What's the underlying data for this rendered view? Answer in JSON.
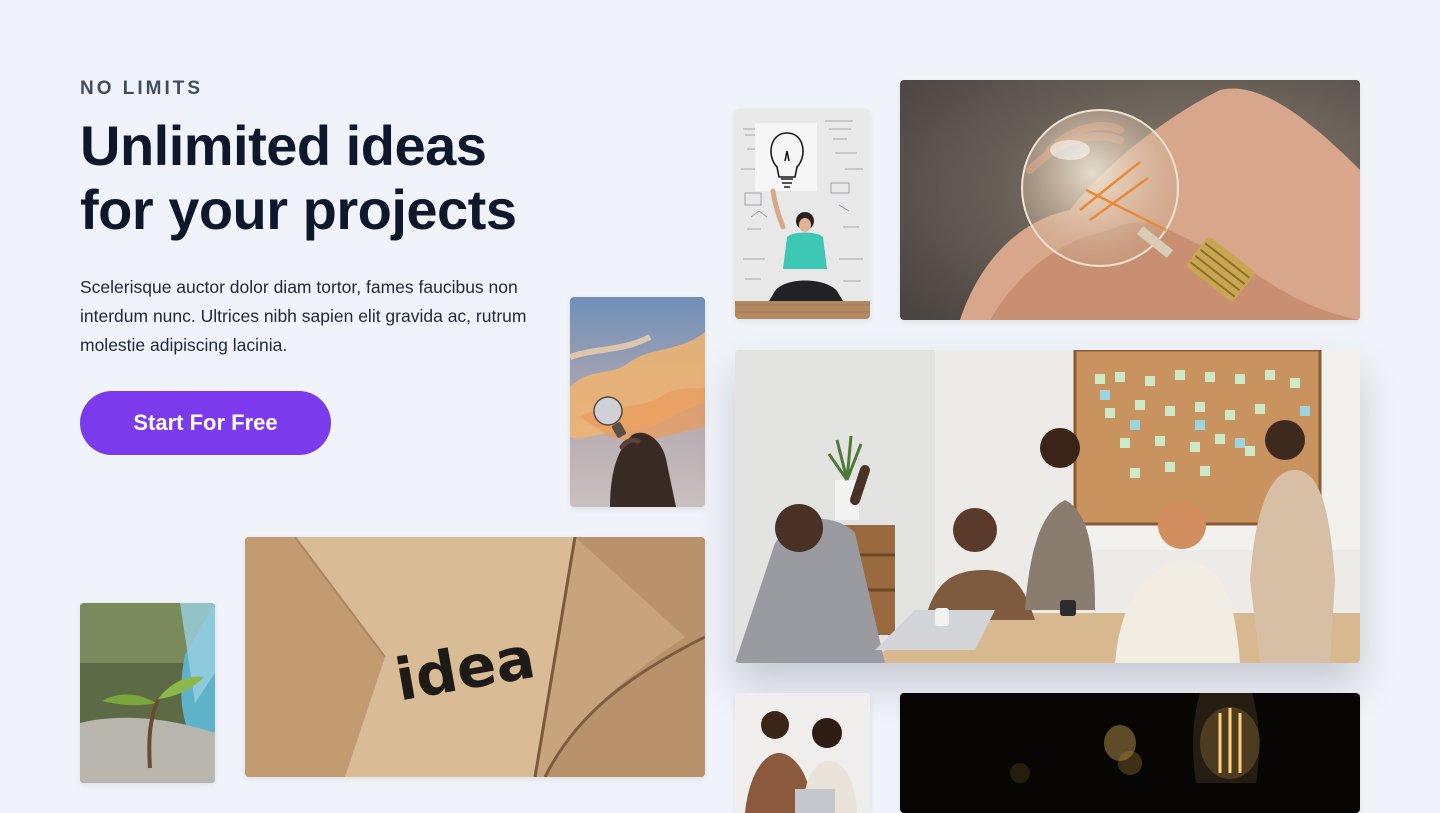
{
  "hero": {
    "eyebrow": "NO LIMITS",
    "headline_line1": "Unlimited ideas",
    "headline_line2": "for your projects",
    "body": "Scelerisque auctor dolor diam tortor, fames faucibus non interdum nunc. Ultrices nibh sapien elit gravida ac, rutrum molestie adipiscing lacinia.",
    "cta_label": "Start For Free"
  },
  "gallery": {
    "idea_card_text": "idea"
  },
  "colors": {
    "background": "#f0f3f9",
    "accent": "#7c3aed",
    "heading": "#0f172a",
    "eyebrow": "#3e4d63",
    "body": "#1e293b"
  }
}
